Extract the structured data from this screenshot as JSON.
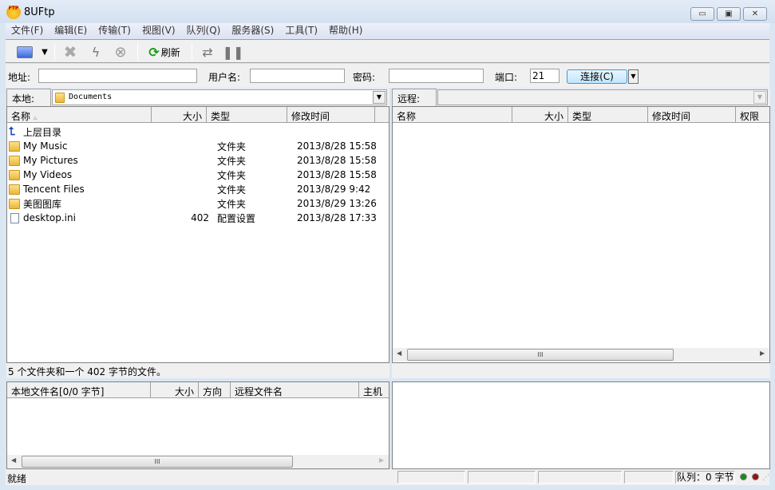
{
  "window": {
    "title": "8UFtp",
    "app_icon_text": "FTP",
    "minimize": "▭",
    "maximize": "▣",
    "close": "✕"
  },
  "menu": [
    "文件(F)",
    "编辑(E)",
    "传输(T)",
    "视图(V)",
    "队列(Q)",
    "服务器(S)",
    "工具(T)",
    "帮助(H)"
  ],
  "toolbar": {
    "refresh_label": "刷新"
  },
  "address_bar": {
    "address_label": "地址:",
    "address_value": "",
    "user_label": "用户名:",
    "user_value": "",
    "password_label": "密码:",
    "password_value": "",
    "port_label": "端口:",
    "port_value": "21",
    "connect_label": "连接(C)"
  },
  "local": {
    "tab_label": "本地:",
    "path": "Documents",
    "columns": [
      "名称",
      "大小",
      "类型",
      "修改时间"
    ],
    "sort_indicator": "▵",
    "rows": [
      {
        "name": "上层目录",
        "size": "",
        "type": "",
        "modified": "",
        "icon": "up-dir"
      },
      {
        "name": "My Music",
        "size": "",
        "type": "文件夹",
        "modified": "2013/8/28 15:58",
        "icon": "folder"
      },
      {
        "name": "My Pictures",
        "size": "",
        "type": "文件夹",
        "modified": "2013/8/28 15:58",
        "icon": "folder"
      },
      {
        "name": "My Videos",
        "size": "",
        "type": "文件夹",
        "modified": "2013/8/28 15:58",
        "icon": "folder"
      },
      {
        "name": "Tencent Files",
        "size": "",
        "type": "文件夹",
        "modified": "2013/8/29 9:42",
        "icon": "folder"
      },
      {
        "name": "美图图库",
        "size": "",
        "type": "文件夹",
        "modified": "2013/8/29 13:26",
        "icon": "folder"
      },
      {
        "name": "desktop.ini",
        "size": "402",
        "type": "配置设置",
        "modified": "2013/8/28 17:33",
        "icon": "file"
      }
    ],
    "status": "5 个文件夹和一个 402 字节的文件。"
  },
  "remote": {
    "tab_label": "远程:",
    "path": "",
    "columns": [
      "名称",
      "大小",
      "类型",
      "修改时间",
      "权限"
    ]
  },
  "queue": {
    "columns": [
      "本地文件名[0/0 字节]",
      "大小",
      "方向",
      "远程文件名",
      "主机"
    ]
  },
  "statusbar": {
    "text": "就绪",
    "queue": "队列：0 字节",
    "indicator_colors": [
      "#1a8a1a",
      "#9a1010"
    ]
  }
}
